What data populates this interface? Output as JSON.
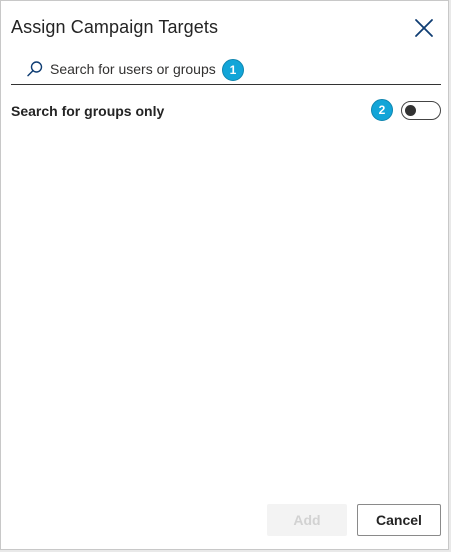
{
  "dialog": {
    "title": "Assign Campaign Targets",
    "close_icon": "close-icon"
  },
  "search": {
    "placeholder": "Search for users or groups",
    "value": "",
    "icon": "search-icon",
    "badge": "1"
  },
  "filter": {
    "label": "Search for groups only",
    "toggle_on": false,
    "badge": "2"
  },
  "footer": {
    "add_label": "Add",
    "add_disabled": true,
    "cancel_label": "Cancel"
  },
  "colors": {
    "badge": "#12a5d8",
    "text": "#242424",
    "close_icon": "#0f3d73"
  }
}
